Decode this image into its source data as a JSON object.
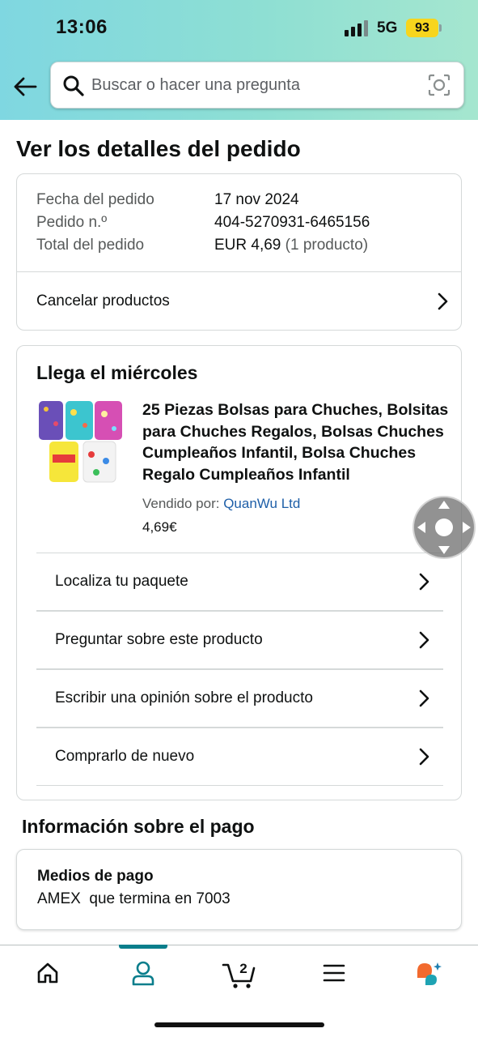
{
  "status_bar": {
    "time": "13:06",
    "network": "5G",
    "battery": "93"
  },
  "search": {
    "placeholder": "Buscar o hacer una pregunta"
  },
  "page_title": "Ver los detalles del pedido",
  "order_summary": {
    "date_label": "Fecha del pedido",
    "date_value": "17 nov 2024",
    "order_no_label": "Pedido n.º",
    "order_no_value": "404-5270931-6465156",
    "total_label": "Total del pedido",
    "total_value": "EUR 4,69",
    "total_count": "(1 producto)",
    "cancel_label": "Cancelar productos"
  },
  "delivery": {
    "title": "Llega el miércoles",
    "product_title": "25 Piezas Bolsas para Chuches, Bolsitas para Chuches Regalos, Bolsas Chuches Cumpleaños Infantil, Bolsa Chuches Regalo Cumpleaños Infantil",
    "sold_by_label": "Vendido por:",
    "seller": "QuanWu Ltd",
    "price": "4,69€",
    "actions": [
      "Localiza tu paquete",
      "Preguntar sobre este producto",
      "Escribir una opinión sobre el producto",
      "Comprarlo de nuevo"
    ]
  },
  "payment": {
    "section_title": "Información sobre el pago",
    "methods_label": "Medios de pago",
    "methods_value": "AMEX  que termina en 7003"
  },
  "tabbar": {
    "active_tab": "account",
    "cart_count": "2",
    "accent": "#0b7e8c"
  }
}
